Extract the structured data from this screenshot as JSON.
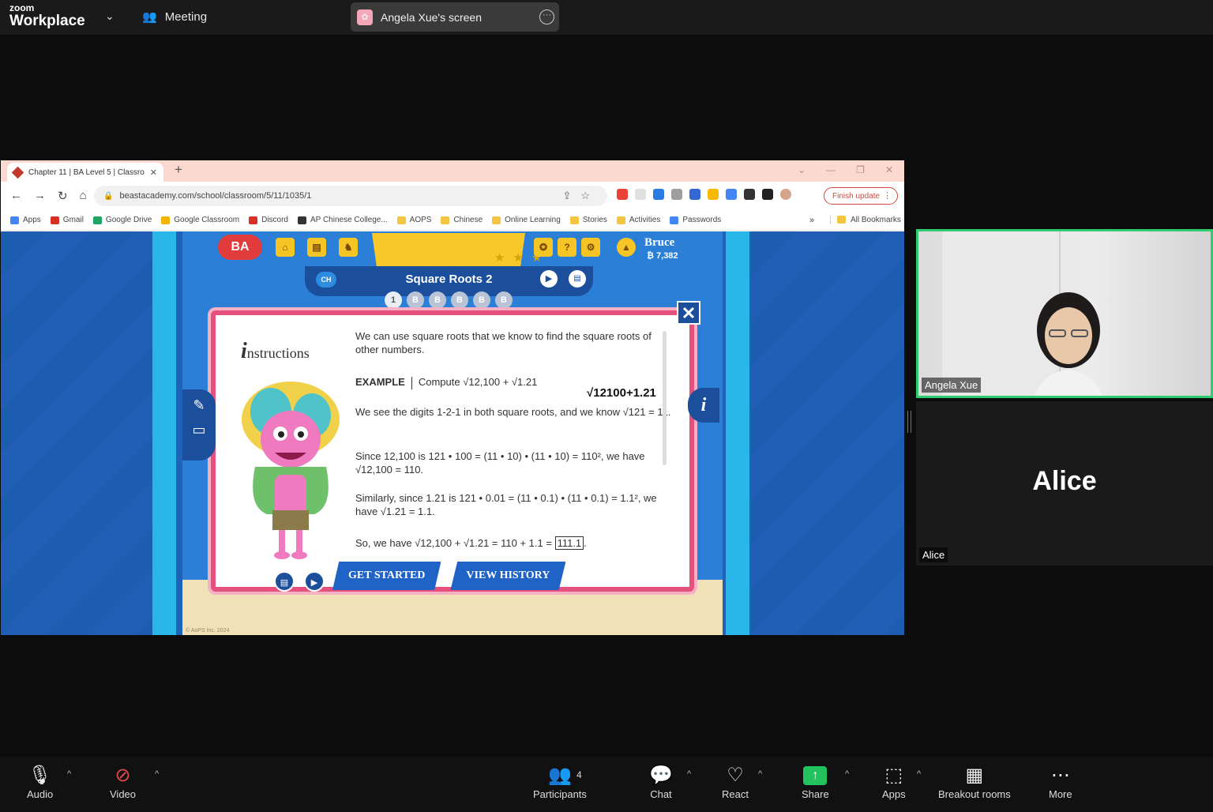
{
  "topbar": {
    "logo_small": "zoom",
    "logo_big": "Workplace",
    "meeting_label": "Meeting",
    "share_title": "Angela Xue's screen"
  },
  "browser": {
    "tab_title": "Chapter 11 | BA Level 5 | Classro",
    "url": "beastacademy.com/school/classroom/5/11/1035/1",
    "finish_update": "Finish update",
    "bookmarks": [
      {
        "label": "Apps",
        "color": "#4285f4"
      },
      {
        "label": "Gmail",
        "color": "#d93025"
      },
      {
        "label": "Google Drive",
        "color": "#1fa463"
      },
      {
        "label": "Google Classroom",
        "color": "#f4b400"
      },
      {
        "label": "Discord",
        "color": "#d93025"
      },
      {
        "label": "AP Chinese College...",
        "color": "#333333"
      },
      {
        "label": "AOPS",
        "color": "#f4c542"
      },
      {
        "label": "Chinese",
        "color": "#f4c542"
      },
      {
        "label": "Online Learning",
        "color": "#f4c542"
      },
      {
        "label": "Stories",
        "color": "#f4c542"
      },
      {
        "label": "Activities",
        "color": "#f4c542"
      },
      {
        "label": "Passwords",
        "color": "#4285f4"
      }
    ],
    "bookmarks_more": "»",
    "all_bookmarks": "All Bookmarks"
  },
  "game": {
    "logo": "BA",
    "player_name": "Bruce",
    "coins": "₿ 7,382",
    "chapter_badge": "CH",
    "lesson_title": "Square Roots 2",
    "level_dots": [
      "1",
      "B",
      "B",
      "B",
      "B",
      "B"
    ],
    "instructions_i": "i",
    "instructions_title": "nstructions",
    "intro": "We can use square roots that we know to find the square roots of other numbers.",
    "example_label": "EXAMPLE",
    "example_compute": "Compute √12,100 + √1.21",
    "handwritten": "√12100+1.21",
    "line1": "We see the digits 1-2-1 in both square roots, and we know √121 = 11.",
    "line2": "Since 12,100 is 121 • 100 = (11 • 10) • (11 • 10) = 110², we have √12,100 = 110.",
    "line3": "Similarly, since 1.21 is 121 • 0.01 = (11 • 0.1) • (11 • 0.1) = 1.1², we have √1.21 = 1.1.",
    "line4_prefix": "So, we have √12,100 + √1.21 = 110 + 1.1 =",
    "line4_answer": "111.1",
    "line4_suffix": ".",
    "btn_get_started": "GET STARTED",
    "btn_view_history": "VIEW HISTORY",
    "copyright": "© AoPS Inc. 2024"
  },
  "participants_tiles": [
    {
      "name": "Angela Xue"
    },
    {
      "name": "Alice",
      "display": "Alice"
    }
  ],
  "bottombar": {
    "audio": "Audio",
    "video": "Video",
    "participants": "Participants",
    "participants_count": "4",
    "chat": "Chat",
    "react": "React",
    "share": "Share",
    "apps": "Apps",
    "breakout": "Breakout rooms",
    "more": "More",
    "share_color": "#22c35e"
  }
}
